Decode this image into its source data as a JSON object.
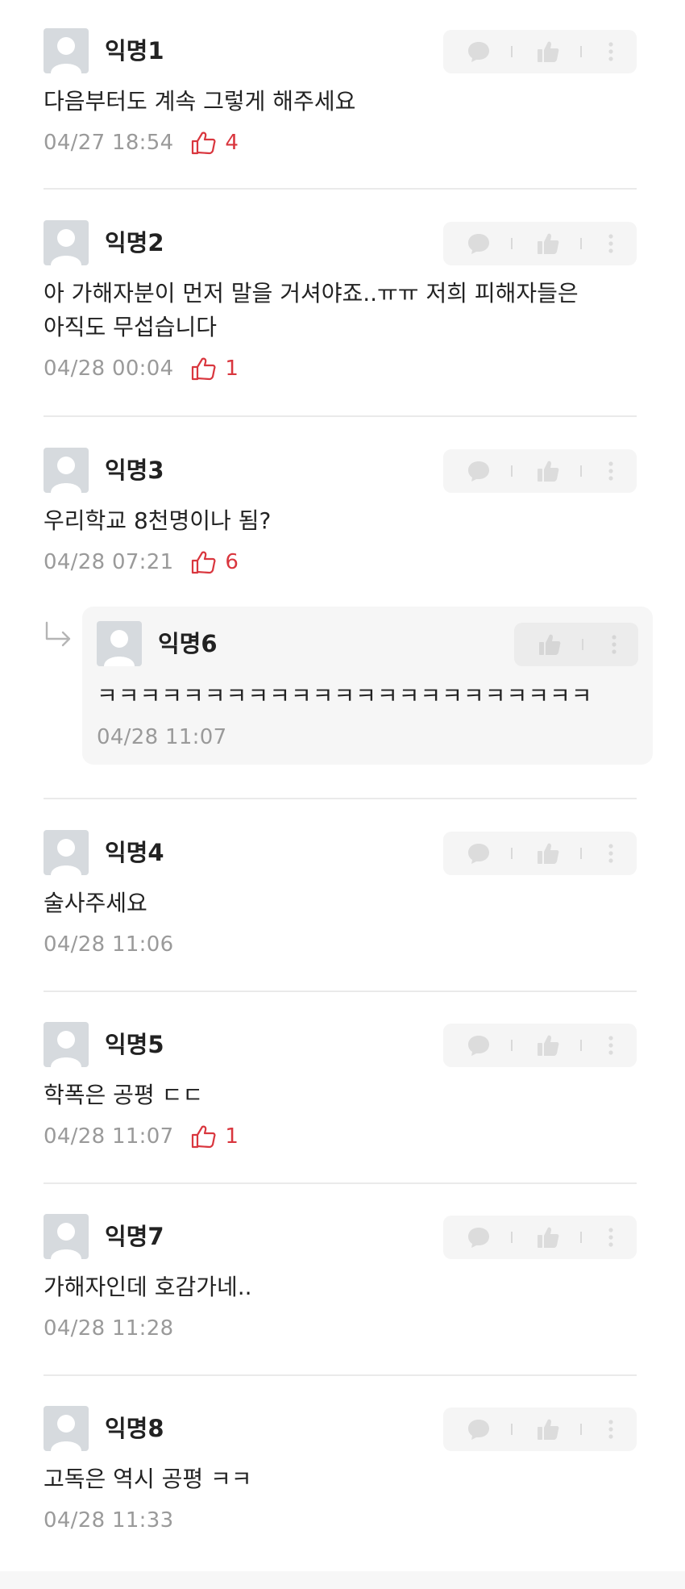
{
  "comments": [
    {
      "author": "익명1",
      "text": "다음부터도 계속 그렇게 해주세요",
      "date": "04/27 18:54",
      "likes": "4"
    },
    {
      "author": "익명2",
      "text": "아 가해자분이 먼저 말을 거셔야죠..ㅠㅠ 저희 피해자들은\n아직도 무섭습니다",
      "date": "04/28 00:04",
      "likes": "1"
    },
    {
      "author": "익명3",
      "text": "우리학교 8천명이나 됨?",
      "date": "04/28 07:21",
      "likes": "6"
    },
    {
      "author": "익명4",
      "text": "술사주세요",
      "date": "04/28 11:06",
      "likes": ""
    },
    {
      "author": "익명5",
      "text": "학폭은 공평 ㄷㄷ",
      "date": "04/28 11:07",
      "likes": "1"
    },
    {
      "author": "익명7",
      "text": "가해자인데 호감가네..",
      "date": "04/28 11:28",
      "likes": ""
    },
    {
      "author": "익명8",
      "text": "고독은 역시 공평 ㅋㅋ",
      "date": "04/28 11:33",
      "likes": ""
    }
  ],
  "reply": {
    "author": "익명6",
    "text": "ㅋㅋㅋㅋㅋㅋㅋㅋㅋㅋㅋㅋㅋㅋㅋㅋㅋㅋㅋㅋㅋㅋㅋ",
    "date": "04/28 11:07"
  },
  "icons": {
    "comment": "comment-icon",
    "like": "thumbs-up-icon",
    "more": "more-vertical-icon",
    "reply_arrow": "reply-arrow-icon",
    "avatar": "avatar-placeholder-icon"
  },
  "colors": {
    "like_accent": "#d9363e",
    "muted": "#9a9a9a",
    "action_bg": "#f5f5f5"
  }
}
